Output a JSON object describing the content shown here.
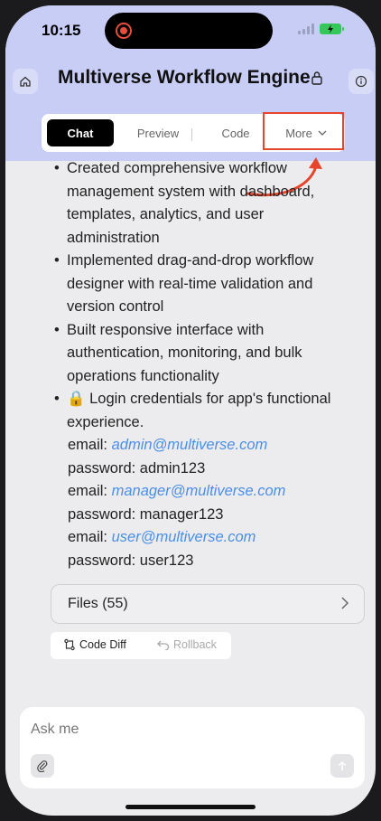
{
  "status": {
    "time": "10:15"
  },
  "header": {
    "title": "Multiverse Workflow Engine"
  },
  "tabs": {
    "chat": "Chat",
    "preview": "Preview",
    "code": "Code",
    "more": "More"
  },
  "content": {
    "bullets": [
      [
        "Created comprehensive workflow",
        "management system with dashboard,",
        "templates, analytics, and user",
        "administration"
      ],
      [
        "Implemented drag-and-drop workflow",
        "designer with real-time validation and",
        "version control"
      ],
      [
        "Built responsive interface with",
        "authentication, monitoring, and bulk",
        "operations functionality"
      ],
      [
        "🔒 Login credentials for app's functional",
        "experience."
      ]
    ],
    "credentials": [
      {
        "email_label": "email: ",
        "email": "admin@multiverse.com",
        "password_label": "password: ",
        "password": "admin123"
      },
      {
        "email_label": "email: ",
        "email": "manager@multiverse.com",
        "password_label": "password: ",
        "password": "manager123"
      },
      {
        "email_label": "email: ",
        "email": "user@multiverse.com",
        "password_label": "password: ",
        "password": "user123"
      }
    ]
  },
  "files": {
    "label": "Files (55)"
  },
  "actions": {
    "code_diff": "Code Diff",
    "rollback": "Rollback"
  },
  "composer": {
    "placeholder": "Ask me"
  },
  "colors": {
    "accent_band": "#c8cdf6",
    "highlight": "#e5452b",
    "link": "#4a8fe7",
    "battery": "#34c759"
  }
}
